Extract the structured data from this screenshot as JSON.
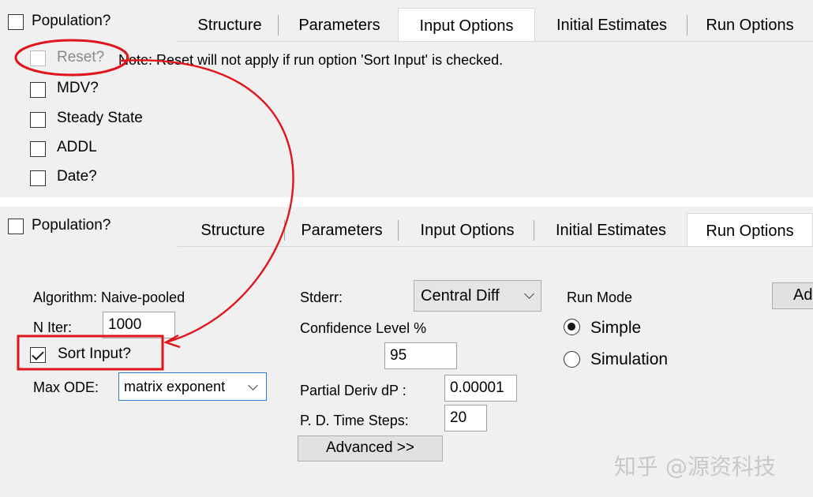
{
  "top": {
    "population_label": "Population?",
    "tabs": [
      "Structure",
      "Parameters",
      "Input Options",
      "Initial Estimates",
      "Run Options"
    ],
    "active_tab": "Input Options",
    "reset_label": "Reset?",
    "note": "Note: Reset will not apply if run option 'Sort Input' is checked.",
    "checkboxes": [
      "MDV?",
      "Steady State",
      "ADDL",
      "Date?"
    ]
  },
  "bottom": {
    "population_label": "Population?",
    "tabs": [
      "Structure",
      "Parameters",
      "Input Options",
      "Initial Estimates",
      "Run Options"
    ],
    "active_tab": "Run Options",
    "algorithm_label": "Algorithm: Naive-pooled",
    "n_iter_label": "N Iter:",
    "n_iter_value": "1000",
    "sort_input_label": "Sort Input?",
    "sort_input_checked": true,
    "max_ode_label": "Max ODE:",
    "max_ode_value": "matrix exponent",
    "stderr_label": "Stderr:",
    "stderr_value": "Central Diff",
    "confidence_label": "Confidence Level %",
    "confidence_value": "95",
    "partial_deriv_label": "Partial Deriv dP :",
    "partial_deriv_value": "0.00001",
    "pd_time_steps_label": "P. D. Time Steps:",
    "pd_time_steps_value": "20",
    "advanced_label": "Advanced >>",
    "run_mode_label": "Run Mode",
    "run_mode_options": [
      "Simple",
      "Simulation"
    ],
    "run_mode_selected": "Simple",
    "cut_button_label": "Ad"
  },
  "watermark": "知乎 @源资科技",
  "annotation_color": "#e0141b"
}
